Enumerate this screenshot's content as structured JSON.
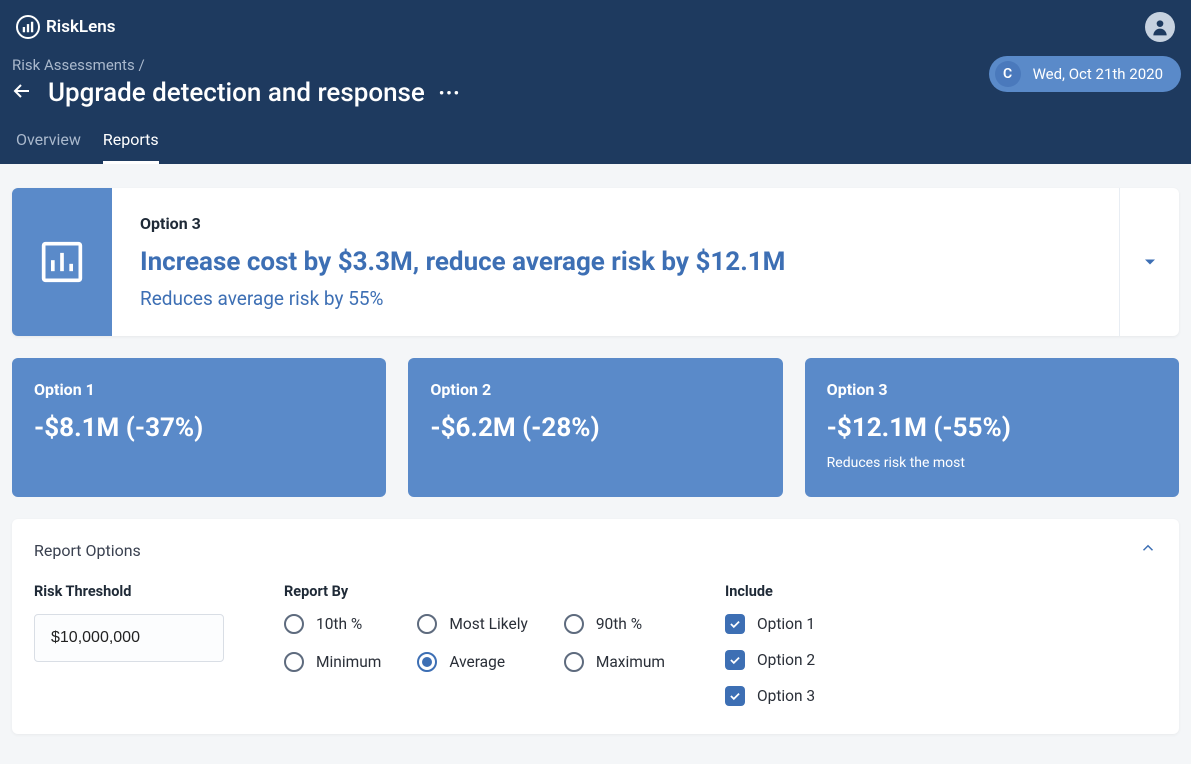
{
  "brand": {
    "name": "RiskLens"
  },
  "breadcrumb": {
    "parent": "Risk Assessments",
    "sep": "/"
  },
  "page": {
    "title": "Upgrade detection and response"
  },
  "pill": {
    "badge": "C",
    "date": "Wed, Oct 21th 2020"
  },
  "tabs": {
    "overview": "Overview",
    "reports": "Reports"
  },
  "hero": {
    "label": "Option 3",
    "heading": "Increase cost by $3.3M, reduce average risk by $12.1M",
    "sub": "Reduces average risk by 55%"
  },
  "options": [
    {
      "title": "Option 1",
      "value": "-$8.1M (-37%)",
      "note": ""
    },
    {
      "title": "Option 2",
      "value": "-$6.2M (-28%)",
      "note": ""
    },
    {
      "title": "Option 3",
      "value": "-$12.1M (-55%)",
      "note": "Reduces risk the most"
    }
  ],
  "report": {
    "panel_title": "Report Options",
    "threshold_label": "Risk Threshold",
    "threshold_value": "$10,000,000",
    "report_by_label": "Report By",
    "report_by": {
      "p10": "10th %",
      "most_likely": "Most Likely",
      "p90": "90th %",
      "minimum": "Minimum",
      "average": "Average",
      "maximum": "Maximum",
      "selected": "average"
    },
    "include_label": "Include",
    "include": [
      {
        "label": "Option 1",
        "checked": true
      },
      {
        "label": "Option 2",
        "checked": true
      },
      {
        "label": "Option 3",
        "checked": true
      }
    ]
  }
}
